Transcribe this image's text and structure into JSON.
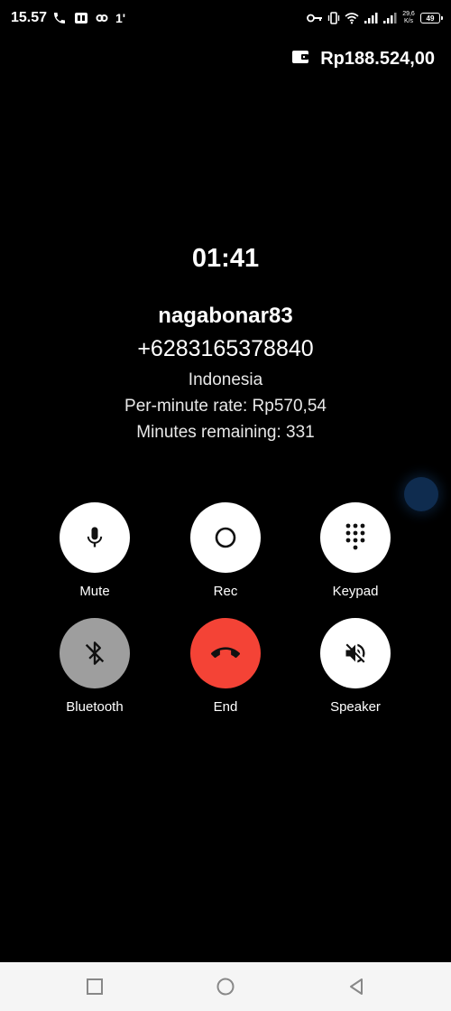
{
  "status_bar": {
    "time": "15.57",
    "extra": "1'",
    "net_speed_value": "29,6",
    "net_speed_unit": "K/s",
    "battery": "49",
    "icons": [
      "phone-icon",
      "sim-icon",
      "link-icon",
      "key-icon",
      "vibrate-icon",
      "wifi-icon",
      "signal-icon"
    ]
  },
  "balance": {
    "amount": "Rp188.524,00",
    "icon": "wallet-icon"
  },
  "call": {
    "timer": "01:41",
    "contact_name": "nagabonar83",
    "phone_number": "+6283165378840",
    "country": "Indonesia",
    "rate": "Per-minute rate: Rp570,54",
    "minutes_remaining": "Minutes remaining: 331"
  },
  "controls": {
    "mute": "Mute",
    "rec": "Rec",
    "keypad": "Keypad",
    "bluetooth": "Bluetooth",
    "end": "End",
    "speaker": "Speaker"
  },
  "colors": {
    "background": "#000000",
    "button_bg": "#ffffff",
    "button_disabled_bg": "#9e9e9e",
    "end_call": "#f44336",
    "nav_bar": "#f5f5f5"
  },
  "nav": {
    "icons": [
      "recent-apps-icon",
      "home-icon",
      "back-icon"
    ]
  }
}
